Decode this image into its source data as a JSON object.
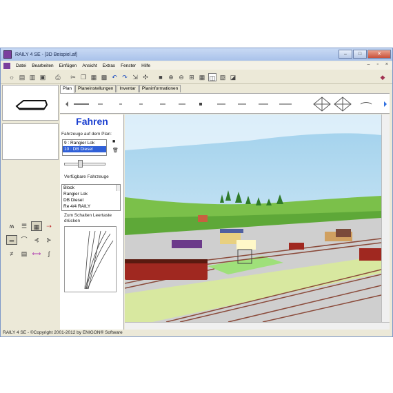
{
  "window": {
    "title": "RAILY 4 SE - [3D Beispiel.af]"
  },
  "menu": [
    "Datei",
    "Bearbeiten",
    "Einfügen",
    "Ansicht",
    "Extras",
    "Fenster",
    "Hilfe"
  ],
  "tabs": [
    "Plan",
    "Planeinstellungen",
    "Inventar",
    "Planinformationen"
  ],
  "drive_panel": {
    "heading": "Fahren",
    "vehicles_label": "Fahrzeuge auf dem Plan:",
    "vehicles": [
      "9 : Rangier Lok",
      "10 : DB Diesel"
    ],
    "available_label": "Verfügbare Fahrzeuge",
    "available": [
      "Block",
      "Rangier Lok",
      "DB Diesel",
      "Re 4/4 RAILY"
    ],
    "switch_hint": "Zum Schalten Leertaste drücken"
  },
  "status": "RAILY 4 SE - ©Copyright 2001-2012 by ENIGON® Software",
  "colors": {
    "sky": "#bfe0f2",
    "grass": "#6fbf3a",
    "ground": "#c8c8c8",
    "track": "#8a4a3a",
    "loco": "#a03020"
  }
}
